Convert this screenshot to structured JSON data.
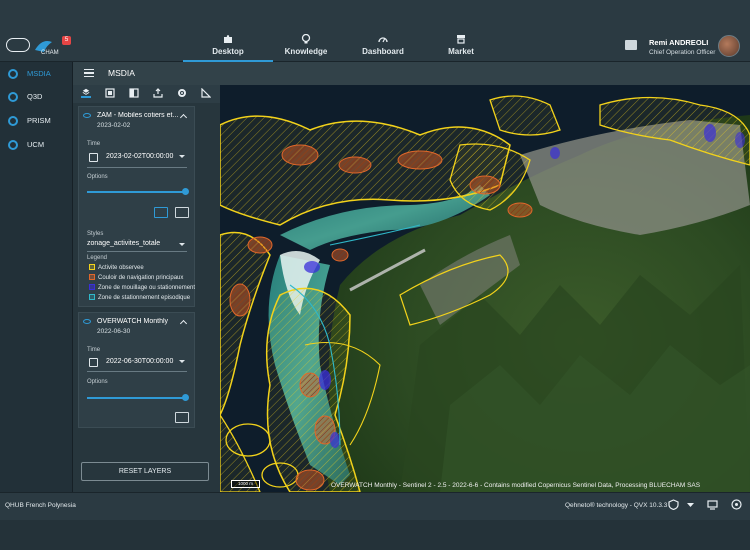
{
  "header": {
    "badge_count": "5",
    "logo_text": "CHAM",
    "nav": [
      {
        "label": "Desktop",
        "active": true
      },
      {
        "label": "Knowledge",
        "active": false
      },
      {
        "label": "Dashboard",
        "active": false
      },
      {
        "label": "Market",
        "active": false
      }
    ],
    "user": {
      "name": "Remi ANDREOLI",
      "role": "Chief Operation Officer"
    }
  },
  "sidebar": {
    "items": [
      {
        "label": "MSDIA",
        "icon": "globe-icon",
        "active": true
      },
      {
        "label": "Q3D",
        "icon": "orbit-icon",
        "active": false
      },
      {
        "label": "PRISM",
        "icon": "radar-icon",
        "active": false
      },
      {
        "label": "UCM",
        "icon": "target-icon",
        "active": false
      }
    ]
  },
  "panel": {
    "title": "MSDIA",
    "tools": [
      "layers-icon",
      "gallery-icon",
      "compare-icon",
      "export-icon",
      "gear-icon",
      "measure-icon"
    ],
    "layers": [
      {
        "title": "ZAM - Mobiles cotiers et...",
        "date": "2023-02-02",
        "time_label": "Time",
        "time_value": "2023-02-02T00:00:00",
        "options_label": "Options",
        "opacity": 1.0,
        "styles_label": "Styles",
        "styles_value": "zonage_activites_totale",
        "legend_label": "Legend",
        "legend": [
          {
            "label": "Activite observee",
            "color": "#f2d21b"
          },
          {
            "label": "Couloir de navigation principaux",
            "color": "#e0672a"
          },
          {
            "label": "Zone de mouillage ou stationnement",
            "color": "#3a2fd9"
          },
          {
            "label": "Zone de stationnement episodique",
            "color": "#2fb8c9"
          }
        ]
      },
      {
        "title": "OVERWATCH Monthly",
        "date": "2022-06-30",
        "time_label": "Time",
        "time_value": "2022-06-30T00:00:00",
        "options_label": "Options",
        "opacity": 1.0
      }
    ],
    "reset_label": "RESET LAYERS"
  },
  "map": {
    "scale_label": "1000 m",
    "attribution": "OVERWATCH Monthly - Sentinel 2 - 2.5 - 2022-6-6 - Contains modified Copernicus Sentinel Data, Processing BLUECHAM SAS"
  },
  "footer": {
    "org": "QHUB French Polynesia",
    "tech": "Qehneto® technology - QVX 10.3.3"
  },
  "colors": {
    "accent": "#2f9ad6",
    "activity": "#f2d21b",
    "navigation": "#e0672a",
    "mooring": "#3a2fd9",
    "episodic": "#2fb8c9"
  }
}
